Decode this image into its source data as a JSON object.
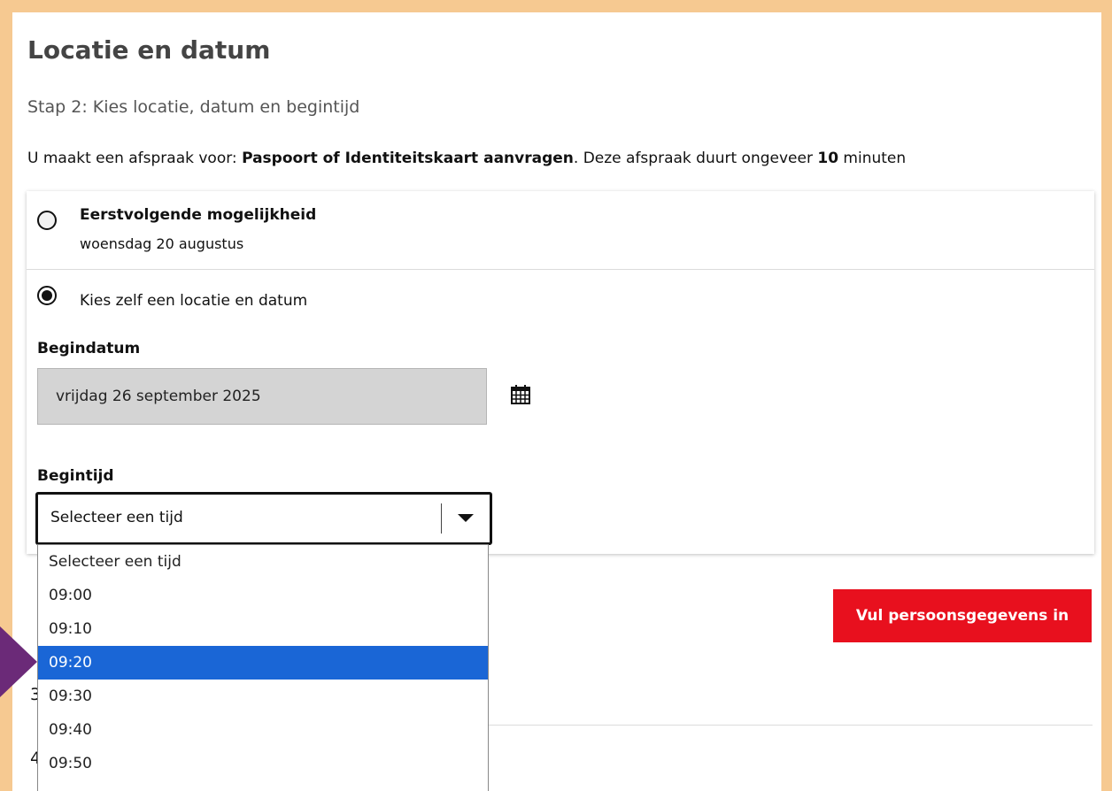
{
  "page": {
    "title": "Locatie en datum",
    "subtitle": "Stap 2: Kies locatie, datum en begintijd",
    "intro_prefix": "U maakt een afspraak voor: ",
    "intro_service": "Paspoort of Identiteitskaart aanvragen",
    "intro_middle": ". Deze afspraak duurt ongeveer ",
    "intro_duration": "10",
    "intro_suffix": " minuten"
  },
  "options": {
    "first": {
      "title": "Eerstvolgende mogelijkheid",
      "date": "woensdag 20 augustus",
      "selected": false
    },
    "custom": {
      "label": "Kies zelf een locatie en datum",
      "selected": true
    }
  },
  "form": {
    "start_date_label": "Begindatum",
    "start_date_value": "vrijdag 26 september 2025",
    "start_time_label": "Begintijd",
    "start_time_value": "Selecteer een tijd",
    "time_options": [
      "Selecteer een tijd",
      "09:00",
      "09:10",
      "09:20",
      "09:30",
      "09:40",
      "09:50"
    ],
    "highlighted_option": "09:20"
  },
  "actions": {
    "next_label": "Vul persoonsgegevens in"
  },
  "steps": {
    "step3": "3",
    "step4": "4"
  },
  "colors": {
    "accent_red": "#e8101e",
    "highlight_blue": "#1a66d6",
    "frame": "#f6c991"
  }
}
